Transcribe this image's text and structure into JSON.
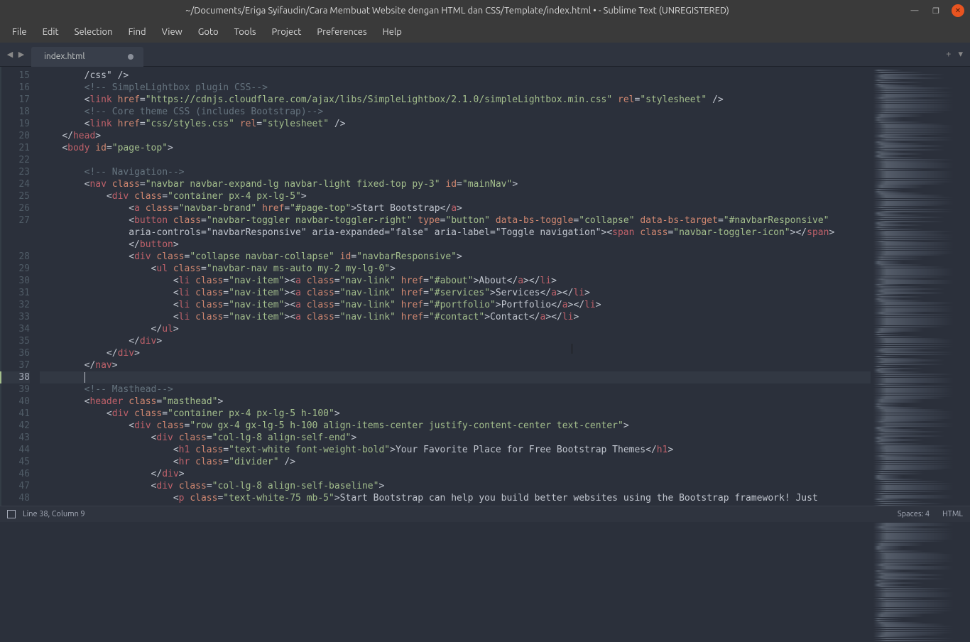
{
  "window": {
    "title": "~/Documents/Eriga Syifaudin/Cara Membuat Website dengan HTML dan CSS/Template/index.html • - Sublime Text (UNREGISTERED)"
  },
  "menu": {
    "file": "File",
    "edit": "Edit",
    "selection": "Selection",
    "find": "Find",
    "view": "View",
    "goto": "Goto",
    "tools": "Tools",
    "project": "Project",
    "preferences": "Preferences",
    "help": "Help"
  },
  "tabs": {
    "t0": "index.html"
  },
  "gutter": {
    "start": 15,
    "end": 48,
    "active": 38
  },
  "code": {
    "l15": "        /css\" />",
    "l16": "        <!-- SimpleLightbox plugin CSS-->",
    "l17": "        <link href=\"https://cdnjs.cloudflare.com/ajax/libs/SimpleLightbox/2.1.0/simpleLightbox.min.css\" rel=\"stylesheet\" />",
    "l18": "        <!-- Core theme CSS (includes Bootstrap)-->",
    "l19": "        <link href=\"css/styles.css\" rel=\"stylesheet\" />",
    "l20": "    </head>",
    "l21": "    <body id=\"page-top\">",
    "l22": "",
    "l23": "        <!-- Navigation-->",
    "l24": "        <nav class=\"navbar navbar-expand-lg navbar-light fixed-top py-3\" id=\"mainNav\">",
    "l25": "            <div class=\"container px-4 px-lg-5\">",
    "l26": "                <a class=\"navbar-brand\" href=\"#page-top\">Start Bootstrap</a>",
    "l27a": "                <button class=\"navbar-toggler navbar-toggler-right\" type=\"button\" data-bs-toggle=\"collapse\" data-bs-target=\"#navbarResponsive\"",
    "l27b": "                aria-controls=\"navbarResponsive\" aria-expanded=\"false\" aria-label=\"Toggle navigation\"><span class=\"navbar-toggler-icon\"></span>",
    "l27c": "                </button>",
    "l28": "                <div class=\"collapse navbar-collapse\" id=\"navbarResponsive\">",
    "l29": "                    <ul class=\"navbar-nav ms-auto my-2 my-lg-0\">",
    "l30": "                        <li class=\"nav-item\"><a class=\"nav-link\" href=\"#about\">About</a></li>",
    "l31": "                        <li class=\"nav-item\"><a class=\"nav-link\" href=\"#services\">Services</a></li>",
    "l32": "                        <li class=\"nav-item\"><a class=\"nav-link\" href=\"#portfolio\">Portfolio</a></li>",
    "l33": "                        <li class=\"nav-item\"><a class=\"nav-link\" href=\"#contact\">Contact</a></li>",
    "l34": "                    </ul>",
    "l35": "                </div>",
    "l36": "            </div>",
    "l37": "        </nav>",
    "l38": "        ",
    "l39": "        <!-- Masthead-->",
    "l40": "        <header class=\"masthead\">",
    "l41": "            <div class=\"container px-4 px-lg-5 h-100\">",
    "l42": "                <div class=\"row gx-4 gx-lg-5 h-100 align-items-center justify-content-center text-center\">",
    "l43": "                    <div class=\"col-lg-8 align-self-end\">",
    "l44": "                        <h1 class=\"text-white font-weight-bold\">Your Favorite Place for Free Bootstrap Themes</h1>",
    "l45": "                        <hr class=\"divider\" />",
    "l46": "                    </div>",
    "l47": "                    <div class=\"col-lg-8 align-self-baseline\">",
    "l48": "                        <p class=\"text-white-75 mb-5\">Start Bootstrap can help you build better websites using the Bootstrap framework! Just"
  },
  "status": {
    "position": "Line 38, Column 9",
    "spaces": "Spaces: 4",
    "syntax": "HTML"
  }
}
